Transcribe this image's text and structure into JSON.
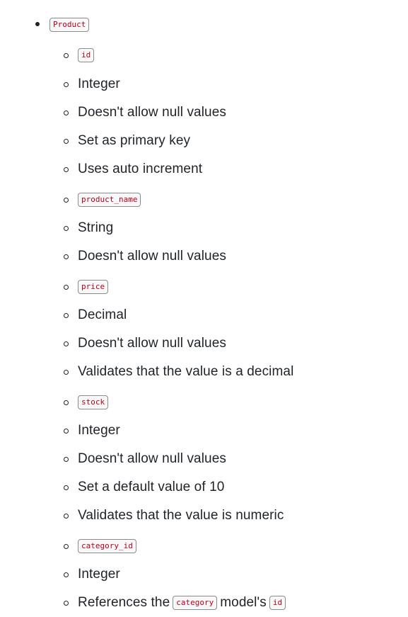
{
  "model": {
    "name": "Product",
    "fields": [
      {
        "name": "id",
        "details": [
          "Integer",
          "Doesn't allow null values",
          "Set as primary key",
          "Uses auto increment"
        ]
      },
      {
        "name": "product_name",
        "details": [
          "String",
          "Doesn't allow null values"
        ]
      },
      {
        "name": "price",
        "details": [
          "Decimal",
          "Doesn't allow null values",
          "Validates that the value is a decimal"
        ]
      },
      {
        "name": "stock",
        "details": [
          "Integer",
          "Doesn't allow null values",
          "Set a default value of 10",
          "Validates that the value is numeric"
        ]
      },
      {
        "name": "category_id",
        "details": [
          "Integer"
        ],
        "reference": {
          "prefix": "References the",
          "model": "category",
          "middle": "model's",
          "field": "id"
        }
      }
    ]
  }
}
